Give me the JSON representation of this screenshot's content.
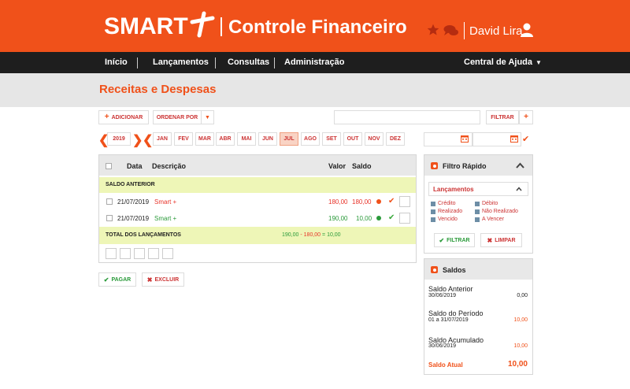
{
  "header": {
    "logo_text": "SMART",
    "app_title": "Controle Financeiro",
    "user_name": "David Lira",
    "icons": [
      "star-icon",
      "chat-icon",
      "user-icon"
    ]
  },
  "nav": {
    "items": [
      "Início",
      "Lançamentos",
      "Consultas",
      "Administração"
    ],
    "help": "Central de Ajuda"
  },
  "page": {
    "title": "Receitas e Despesas"
  },
  "toolbar": {
    "add_label": "ADICIONAR",
    "sort_label": "ORDENAR POR",
    "filter_label": "FILTRAR",
    "search_value": ""
  },
  "months": {
    "year": "2019",
    "list": [
      "JAN",
      "FEV",
      "MAR",
      "ABR",
      "MAI",
      "JUN",
      "JUL",
      "AGO",
      "SET",
      "OUT",
      "NOV",
      "DEZ"
    ],
    "active": "JUL"
  },
  "table": {
    "headers": {
      "date": "Data",
      "description": "Descrição",
      "value": "Valor",
      "balance": "Saldo"
    },
    "opening_label": "SALDO ANTERIOR",
    "rows": [
      {
        "date": "21/07/2019",
        "description": "Smart +",
        "value": "180,00",
        "balance": "180,00",
        "type": "expense"
      },
      {
        "date": "21/07/2019",
        "description": "Smart +",
        "value": "190,00",
        "balance": "10,00",
        "type": "income"
      }
    ],
    "total_label": "TOTAL DOS LANÇAMENTOS",
    "total_income": "190,00",
    "total_sep1": " - ",
    "total_expense": "180,00",
    "total_sep2": " = ",
    "total_result": "10,00"
  },
  "actions": {
    "pay_label": "PAGAR",
    "delete_label": "EXCLUIR"
  },
  "quick_filter": {
    "title": "Filtro Rápido",
    "dropdown_label": "Lançamentos",
    "options": [
      "Crédito",
      "Débito",
      "Realizado",
      "Não Realizado",
      "Vencido",
      "A Vencer"
    ],
    "filter_label": "FILTRAR",
    "clear_label": "LIMPAR"
  },
  "balances": {
    "title": "Saldos",
    "previous_label": "Saldo Anterior",
    "previous_date": "30/06/2019",
    "previous_value": "0,00",
    "period_label": "Saldo do Período",
    "period_date": "01 a 31/07/2019",
    "period_value": "10,00",
    "accum_label": "Saldo Acumulado",
    "accum_date": "30/06/2019",
    "accum_value": "10,00",
    "current_label": "Saldo Atual",
    "current_value": "10,00"
  },
  "colors": {
    "brand": "#f0511a",
    "nav_bg": "#1e1e1e",
    "highlight_row": "#eef6b7",
    "income": "#2a9a3a",
    "expense": "#e8342a"
  }
}
